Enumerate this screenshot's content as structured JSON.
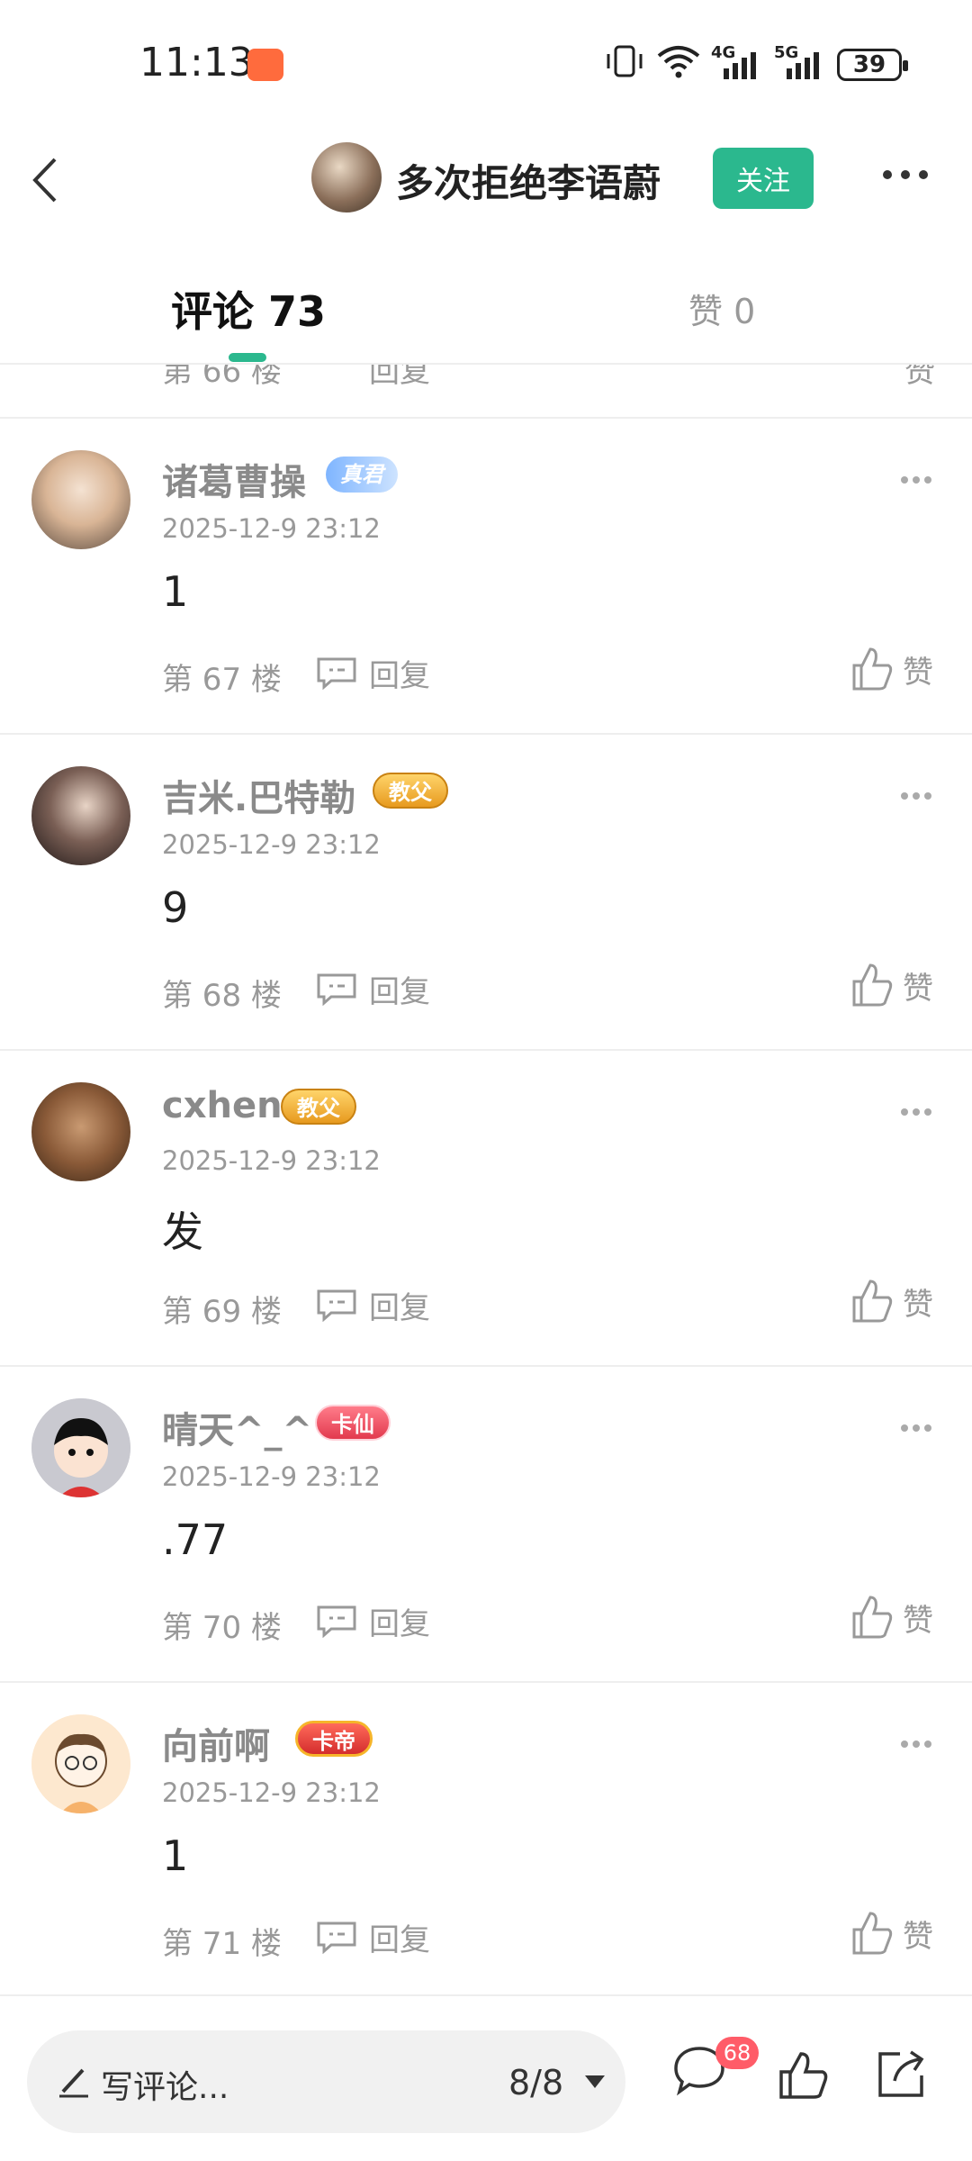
{
  "status_bar": {
    "time": "11:13",
    "battery": "39",
    "network_1": "4G",
    "network_2": "5G"
  },
  "header": {
    "author_name": "多次拒绝李语蔚",
    "follow_label": "关注"
  },
  "tabs": {
    "comments_label": "评论 73",
    "likes_label": "赞 0"
  },
  "partial_comment": {
    "floor_label": "第 66 楼",
    "reply_label": "回复",
    "like_label": "赞"
  },
  "comments": [
    {
      "username": "诸葛曹操",
      "badge_text": "真君",
      "timestamp": "2025-12-9 23:12",
      "content": "1",
      "floor_label": "第 67 楼",
      "reply_label": "回复",
      "like_label": "赞"
    },
    {
      "username": "吉米.巴特勒",
      "badge_text": "教父",
      "timestamp": "2025-12-9 23:12",
      "content": "9",
      "floor_label": "第 68 楼",
      "reply_label": "回复",
      "like_label": "赞"
    },
    {
      "username": "cxhen",
      "badge_text": "教父",
      "timestamp": "2025-12-9 23:12",
      "content": "发",
      "floor_label": "第 69 楼",
      "reply_label": "回复",
      "like_label": "赞"
    },
    {
      "username": "晴天^_^",
      "badge_text": "卡仙",
      "timestamp": "2025-12-9 23:12",
      "content": ".77",
      "floor_label": "第 70 楼",
      "reply_label": "回复",
      "like_label": "赞"
    },
    {
      "username": "向前啊",
      "badge_text": "卡帝",
      "timestamp": "2025-12-9 23:12",
      "content": "1",
      "floor_label": "第 71 楼",
      "reply_label": "回复",
      "like_label": "赞"
    }
  ],
  "bottom_bar": {
    "write_placeholder": "写评论...",
    "page_indicator": "8/8",
    "comment_count": "68"
  },
  "colors": {
    "accent": "#2bb88e",
    "muted_text": "#999999",
    "badge_red": "#ff5c68"
  },
  "icons": [
    "back-arrow-icon",
    "more-horizontal-icon",
    "reply-bubble-icon",
    "thumbs-up-icon",
    "pen-icon",
    "dropdown-triangle-icon",
    "comment-bubble-icon",
    "share-icon",
    "vibrate-icon",
    "wifi-icon",
    "signal-icon"
  ]
}
